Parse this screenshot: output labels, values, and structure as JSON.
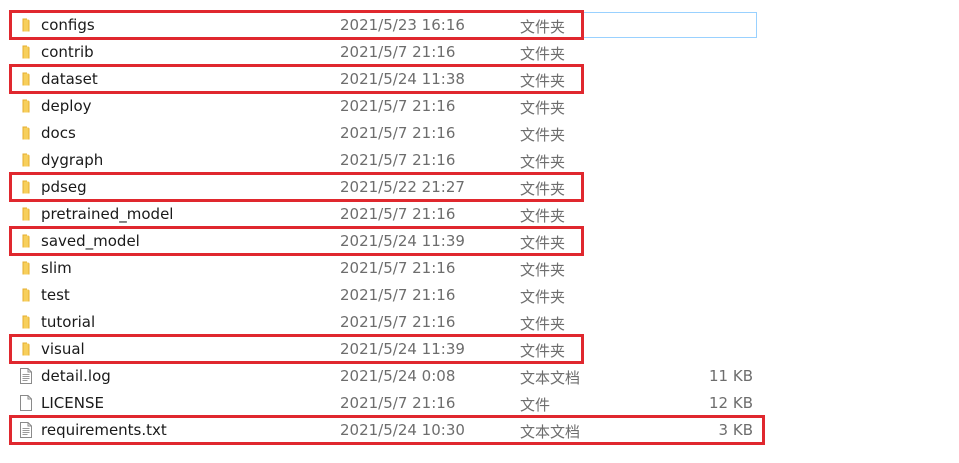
{
  "files": [
    {
      "name": "configs",
      "date": "2021/5/23 16:16",
      "type": "文件夹",
      "size": "",
      "icon": "folder-icon",
      "highlighted": true,
      "selected": true
    },
    {
      "name": "contrib",
      "date": "2021/5/7 21:16",
      "type": "文件夹",
      "size": "",
      "icon": "folder-icon",
      "highlighted": false
    },
    {
      "name": "dataset",
      "date": "2021/5/24 11:38",
      "type": "文件夹",
      "size": "",
      "icon": "folder-icon",
      "highlighted": true
    },
    {
      "name": "deploy",
      "date": "2021/5/7 21:16",
      "type": "文件夹",
      "size": "",
      "icon": "folder-icon",
      "highlighted": false
    },
    {
      "name": "docs",
      "date": "2021/5/7 21:16",
      "type": "文件夹",
      "size": "",
      "icon": "folder-icon",
      "highlighted": false
    },
    {
      "name": "dygraph",
      "date": "2021/5/7 21:16",
      "type": "文件夹",
      "size": "",
      "icon": "folder-icon",
      "highlighted": false
    },
    {
      "name": "pdseg",
      "date": "2021/5/22 21:27",
      "type": "文件夹",
      "size": "",
      "icon": "folder-icon",
      "highlighted": true
    },
    {
      "name": "pretrained_model",
      "date": "2021/5/7 21:16",
      "type": "文件夹",
      "size": "",
      "icon": "folder-icon",
      "highlighted": false
    },
    {
      "name": "saved_model",
      "date": "2021/5/24 11:39",
      "type": "文件夹",
      "size": "",
      "icon": "folder-icon",
      "highlighted": true
    },
    {
      "name": "slim",
      "date": "2021/5/7 21:16",
      "type": "文件夹",
      "size": "",
      "icon": "folder-icon",
      "highlighted": false
    },
    {
      "name": "test",
      "date": "2021/5/7 21:16",
      "type": "文件夹",
      "size": "",
      "icon": "folder-icon",
      "highlighted": false
    },
    {
      "name": "tutorial",
      "date": "2021/5/7 21:16",
      "type": "文件夹",
      "size": "",
      "icon": "folder-icon",
      "highlighted": false
    },
    {
      "name": "visual",
      "date": "2021/5/24 11:39",
      "type": "文件夹",
      "size": "",
      "icon": "folder-icon",
      "highlighted": true
    },
    {
      "name": "detail.log",
      "date": "2021/5/24 0:08",
      "type": "文本文档",
      "size": "11 KB",
      "icon": "text-file-icon",
      "highlighted": false
    },
    {
      "name": "LICENSE",
      "date": "2021/5/7 21:16",
      "type": "文件",
      "size": "12 KB",
      "icon": "blank-file-icon",
      "highlighted": false
    },
    {
      "name": "requirements.txt",
      "date": "2021/5/24 10:30",
      "type": "文本文档",
      "size": "3 KB",
      "icon": "text-file-icon",
      "highlighted": true
    }
  ],
  "colors": {
    "highlight_border": "#e0282e",
    "selection_border": "#99d1ff",
    "folder_fill": "#f7cf5c",
    "folder_dark": "#e4ad2e",
    "meta_text": "#6d6d6d",
    "name_text": "#1a1a1a"
  }
}
